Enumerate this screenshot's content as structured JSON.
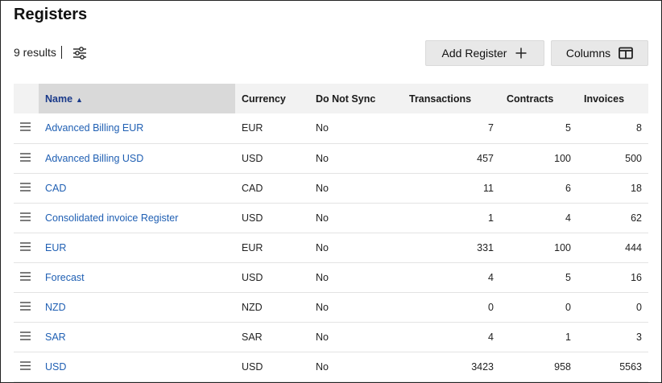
{
  "page": {
    "title": "Registers"
  },
  "toolbar": {
    "results_label": "9 results",
    "add_register_label": "Add Register",
    "columns_label": "Columns"
  },
  "table": {
    "headers": {
      "name": "Name",
      "currency": "Currency",
      "do_not_sync": "Do Not Sync",
      "transactions": "Transactions",
      "contracts": "Contracts",
      "invoices": "Invoices"
    },
    "sort": {
      "column": "name",
      "direction": "ascending"
    },
    "rows": [
      {
        "name": "Advanced Billing EUR",
        "currency": "EUR",
        "do_not_sync": "No",
        "transactions": "7",
        "contracts": "5",
        "invoices": "8"
      },
      {
        "name": "Advanced Billing USD",
        "currency": "USD",
        "do_not_sync": "No",
        "transactions": "457",
        "contracts": "100",
        "invoices": "500"
      },
      {
        "name": "CAD",
        "currency": "CAD",
        "do_not_sync": "No",
        "transactions": "11",
        "contracts": "6",
        "invoices": "18"
      },
      {
        "name": "Consolidated invoice Register",
        "currency": "USD",
        "do_not_sync": "No",
        "transactions": "1",
        "contracts": "4",
        "invoices": "62"
      },
      {
        "name": "EUR",
        "currency": "EUR",
        "do_not_sync": "No",
        "transactions": "331",
        "contracts": "100",
        "invoices": "444"
      },
      {
        "name": "Forecast",
        "currency": "USD",
        "do_not_sync": "No",
        "transactions": "4",
        "contracts": "5",
        "invoices": "16"
      },
      {
        "name": "NZD",
        "currency": "NZD",
        "do_not_sync": "No",
        "transactions": "0",
        "contracts": "0",
        "invoices": "0"
      },
      {
        "name": "SAR",
        "currency": "SAR",
        "do_not_sync": "No",
        "transactions": "4",
        "contracts": "1",
        "invoices": "3"
      },
      {
        "name": "USD",
        "currency": "USD",
        "do_not_sync": "No",
        "transactions": "3423",
        "contracts": "958",
        "invoices": "5563"
      }
    ]
  },
  "icons": {
    "filter": "sliders-icon",
    "add": "plus-icon",
    "columns": "columns-icon",
    "row_handle": "drag-handle-icon",
    "sort": "sort-ascending-icon"
  },
  "colors": {
    "link": "#1f5fb3",
    "header_bg": "#f2f2f2",
    "sorted_header_bg": "#d9d9d9",
    "sorted_header_text": "#1a3a8a",
    "button_bg": "#e8e8e8"
  }
}
